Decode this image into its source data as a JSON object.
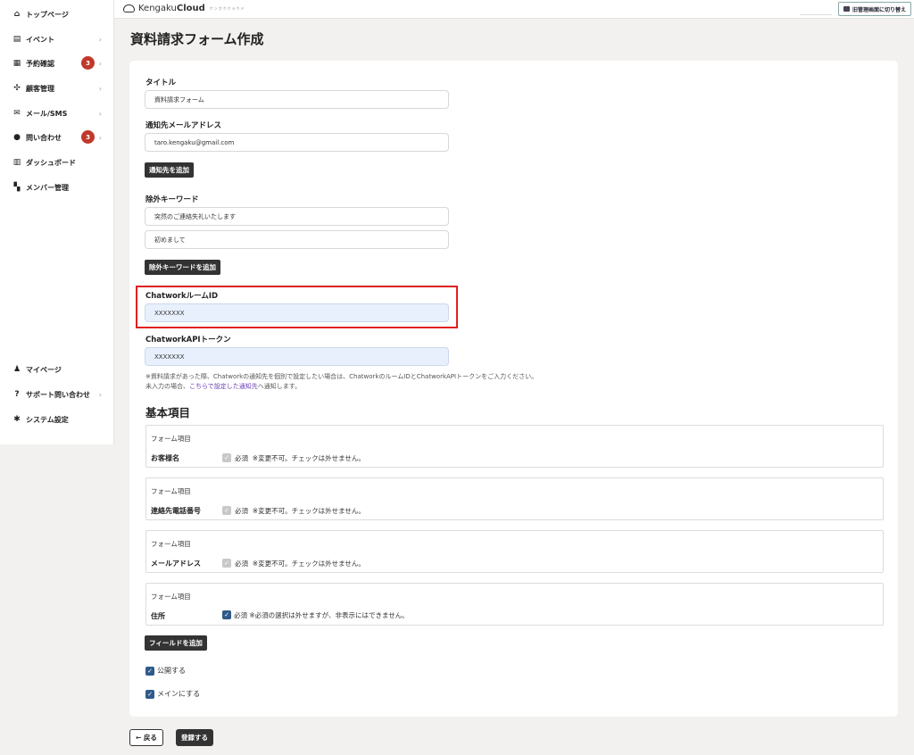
{
  "sidebar": {
    "items": [
      {
        "label": "トップページ",
        "icon": "home-icon"
      },
      {
        "label": "イベント",
        "icon": "document-icon"
      },
      {
        "label": "予約確認",
        "icon": "calendar-icon",
        "badge": "3"
      },
      {
        "label": "顧客管理",
        "icon": "people-icon"
      },
      {
        "label": "メール/SMS",
        "icon": "mail-icon"
      },
      {
        "label": "問い合わせ",
        "icon": "chat-icon",
        "badge": "3"
      },
      {
        "label": "ダッシュボード",
        "icon": "chart-icon"
      },
      {
        "label": "メンバー管理",
        "icon": "grid-icon"
      }
    ],
    "bottom_items": [
      {
        "label": "マイページ",
        "icon": "user-icon"
      },
      {
        "label": "サポート問い合わせ",
        "icon": "help-icon"
      },
      {
        "label": "システム設定",
        "icon": "gear-icon"
      }
    ]
  },
  "topbar": {
    "logo_prefix": "Kengaku",
    "logo_bold": "Cloud",
    "logo_tag": "ケンガククラウド",
    "switch_label": "旧管理画面に切り替え"
  },
  "page": {
    "title": "資料請求フォーム作成"
  },
  "form": {
    "title_label": "タイトル",
    "title_value": "資料請求フォーム",
    "email_label": "通知先メールアドレス",
    "email_value": "taro.kengaku@gmail.com",
    "add_notify_button": "通知先を追加",
    "exclude_label": "除外キーワード",
    "exclude_values": [
      "突然のご連絡失礼いたします",
      "初めまして"
    ],
    "add_exclude_button": "除外キーワードを追加",
    "chatwork_room_label": "ChatworkルームID",
    "chatwork_room_value": "XXXXXXX",
    "chatwork_token_label": "ChatworkAPIトークン",
    "chatwork_token_value": "XXXXXXX",
    "note_line1": "※資料請求があった際、Chatworkの通知先を個別で設定したい場合は、ChatworkのルームIDとChatworkAPIトークンをご入力ください。",
    "note_line2_prefix": "未入力の場合、",
    "note_line2_link": "こちらで設定した通知先",
    "note_line2_suffix": "へ通知します。"
  },
  "basic": {
    "title": "基本項目",
    "fields": [
      {
        "header": "フォーム項目",
        "name": "お客様名",
        "required": "必須",
        "note": "※変更不可。チェックは外せません。",
        "checked_active": false
      },
      {
        "header": "フォーム項目",
        "name": "連絡先電話番号",
        "required": "必須",
        "note": "※変更不可。チェックは外せません。",
        "checked_active": false
      },
      {
        "header": "フォーム項目",
        "name": "メールアドレス",
        "required": "必須",
        "note": "※変更不可。チェックは外せません。",
        "checked_active": false
      },
      {
        "header": "フォーム項目",
        "name": "住所",
        "required": "必須",
        "note": "※必須の選択は外せますが、非表示にはできません。",
        "checked_active": true
      }
    ],
    "add_field_button": "フィールドを追加",
    "publish_label": "公開する",
    "main_label": "メインにする"
  },
  "footer": {
    "back_label": "← 戻る",
    "save_label": "登録する"
  },
  "colors": {
    "accent": "#2f5a8a",
    "badge": "#c0392b",
    "highlight": "#e02020"
  }
}
